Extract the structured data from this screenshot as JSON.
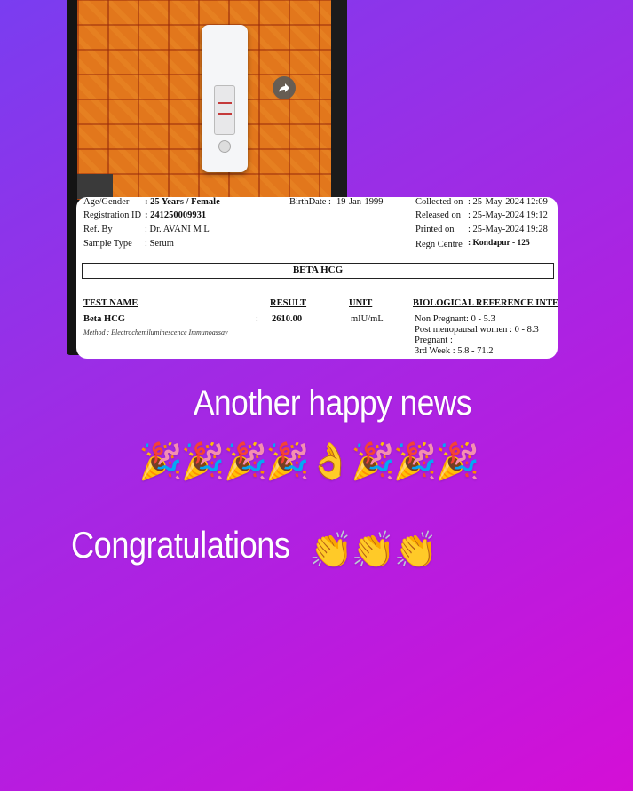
{
  "report": {
    "age_gender_label": "Age/Gender",
    "age_gender_value": ": 25 Years / Female",
    "birthdate_label": "BirthDate :",
    "birthdate_value": "19-Jan-1999",
    "collected_label": "Collected on",
    "collected_value": ": 25-May-2024 12:09",
    "registration_label": "Registration ID",
    "registration_value": ": 241250009931",
    "released_label": "Released on",
    "released_value": ": 25-May-2024 19:12",
    "ref_label": "Ref. By",
    "ref_value": ": Dr. AVANI M L",
    "printed_label": "Printed on",
    "printed_value": ": 25-May-2024 19:28",
    "sample_label": "Sample Type",
    "sample_value": ": Serum",
    "centre_label": "Regn Centre",
    "centre_value": ": Kondapur - 125",
    "section_title": "BETA HCG",
    "col_test": "TEST NAME",
    "col_result": "RESULT",
    "col_unit": "UNIT",
    "col_ref": "BIOLOGICAL REFERENCE INTE",
    "test_name": "Beta HCG",
    "colon": ":",
    "result": "2610.00",
    "unit": "mIU/mL",
    "method": "Method : Electrochemiluminescence Immunoassay",
    "ref_lines": [
      "Non Pregnant: 0 - 5.3",
      "Post menopausal women : 0 - 8.3",
      "Pregnant :",
      "3rd Week : 5.8 - 71.2"
    ]
  },
  "story": {
    "headline": "Another happy news",
    "emoji_row1": "🎉🎉🎉🎉👌🎉🎉🎉",
    "congrats": "Congratulations",
    "emoji_row2": "👏👏👏"
  },
  "icons": {
    "share": "share-arrow-icon"
  },
  "colors": {
    "bg_start": "#7a3df0",
    "bg_end": "#d40fd6",
    "text": "#ffffff"
  }
}
